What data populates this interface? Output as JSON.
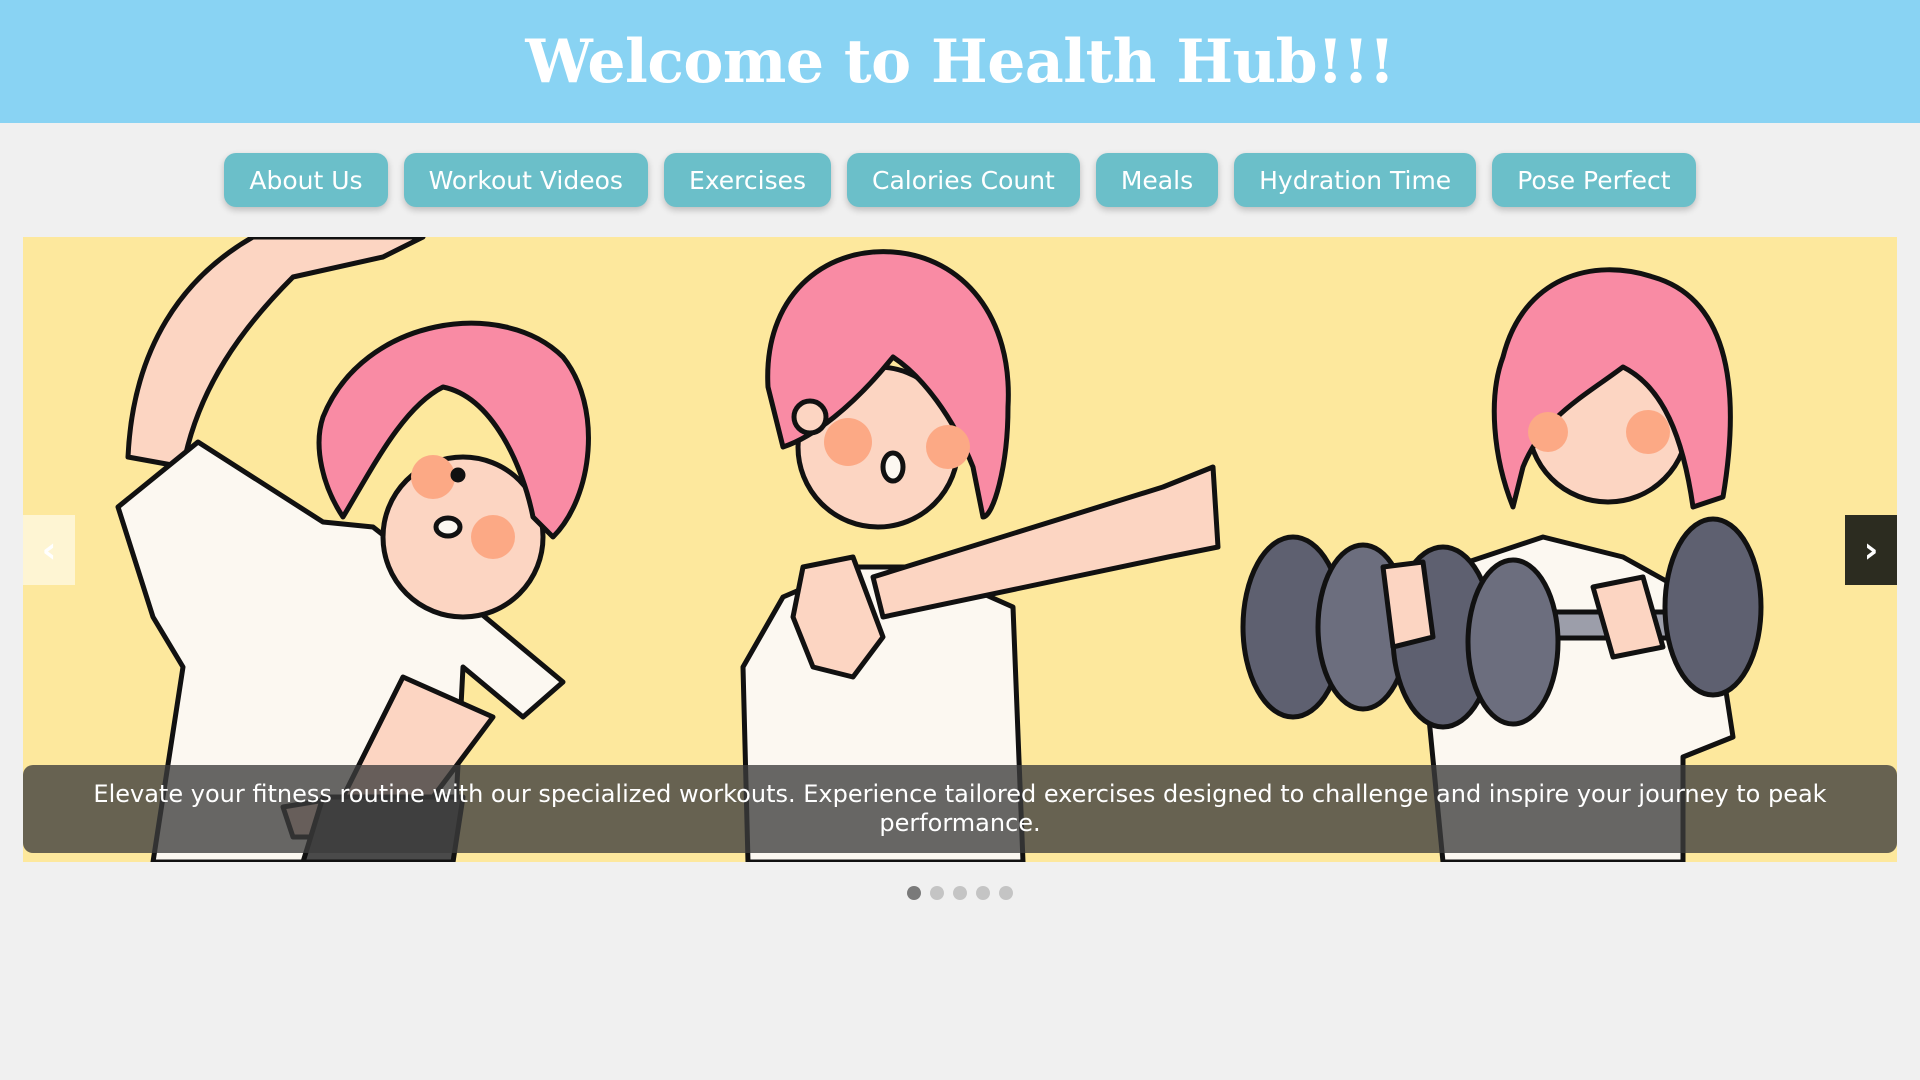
{
  "header": {
    "title": "Welcome to Health Hub!!!"
  },
  "nav": {
    "items": [
      {
        "label": "About Us"
      },
      {
        "label": "Workout Videos"
      },
      {
        "label": "Exercises"
      },
      {
        "label": "Calories Count"
      },
      {
        "label": "Meals"
      },
      {
        "label": "Hydration Time"
      },
      {
        "label": "Pose Perfect"
      }
    ]
  },
  "slider": {
    "caption": "Elevate your fitness routine with our specialized workouts. Experience tailored exercises designed to challenge and inspire your journey to peak performance.",
    "prev_icon": "‹",
    "next_icon": "›",
    "slide_count": 5,
    "active_slide": 1
  },
  "colors": {
    "header_bg": "#89d3f3",
    "nav_button": "#6bbfc9",
    "slide_bg": "#fde89d",
    "hair": "#f98ba4",
    "shirt": "#fcf8f1",
    "dumbbell": "#5e6070"
  }
}
